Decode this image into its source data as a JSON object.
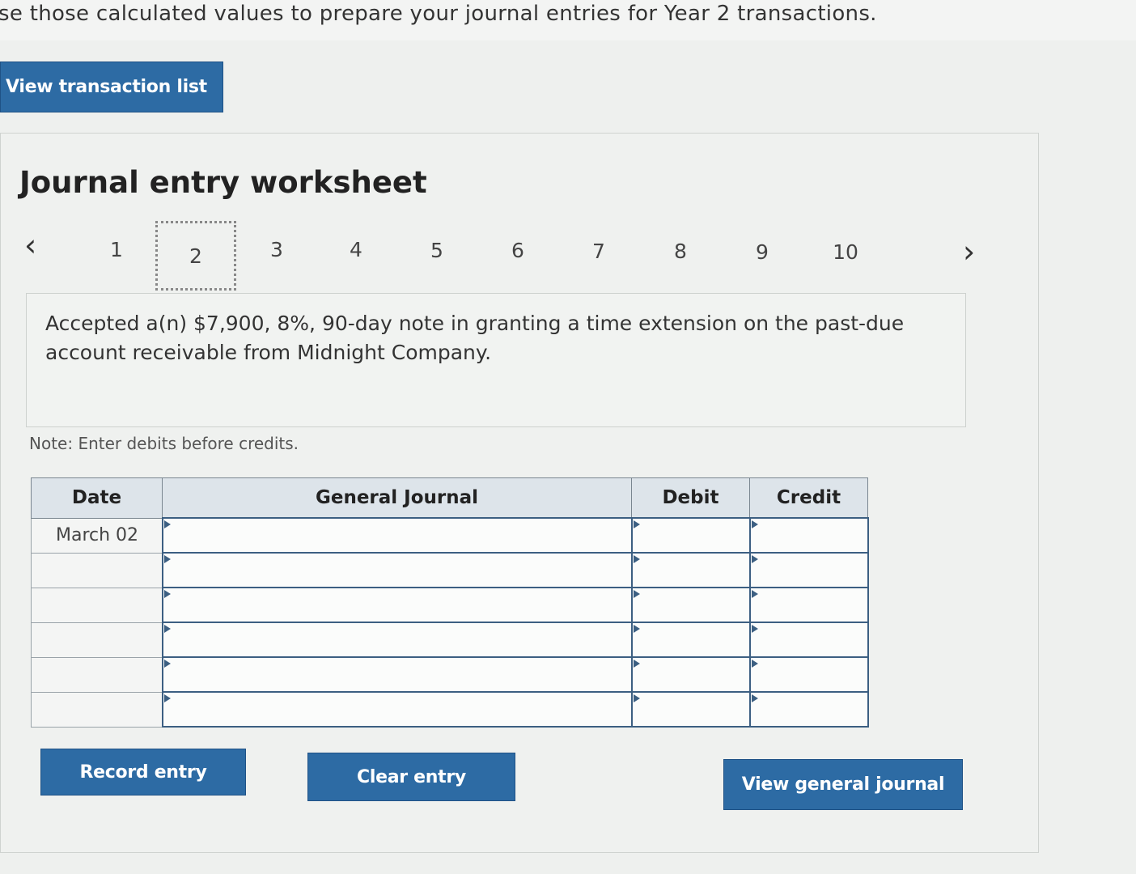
{
  "instruction_text": "se those calculated values to prepare your journal entries for Year 2 transactions.",
  "view_transaction_list_label": "View transaction list",
  "worksheet": {
    "title": "Journal entry worksheet",
    "steps": [
      "1",
      "2",
      "3",
      "4",
      "5",
      "6",
      "7",
      "8",
      "9",
      "10"
    ],
    "active_step": "2",
    "prev_icon": "chevron-left-icon",
    "next_icon": "chevron-right-icon",
    "description": "Accepted a(n) $7,900, 8%, 90-day note in granting a time extension on the past-due account receivable from Midnight Company.",
    "note": "Note: Enter debits before credits."
  },
  "journal": {
    "headers": {
      "date": "Date",
      "general_journal": "General Journal",
      "debit": "Debit",
      "credit": "Credit"
    },
    "rows": [
      {
        "date": "March 02",
        "account": "",
        "debit": "",
        "credit": ""
      },
      {
        "date": "",
        "account": "",
        "debit": "",
        "credit": ""
      },
      {
        "date": "",
        "account": "",
        "debit": "",
        "credit": ""
      },
      {
        "date": "",
        "account": "",
        "debit": "",
        "credit": ""
      },
      {
        "date": "",
        "account": "",
        "debit": "",
        "credit": ""
      },
      {
        "date": "",
        "account": "",
        "debit": "",
        "credit": ""
      }
    ]
  },
  "buttons": {
    "record_entry": "Record entry",
    "clear_entry": "Clear entry",
    "view_general_journal": "View general journal"
  },
  "colors": {
    "button_blue": "#2d6ba4",
    "table_border": "#3c5f82"
  }
}
